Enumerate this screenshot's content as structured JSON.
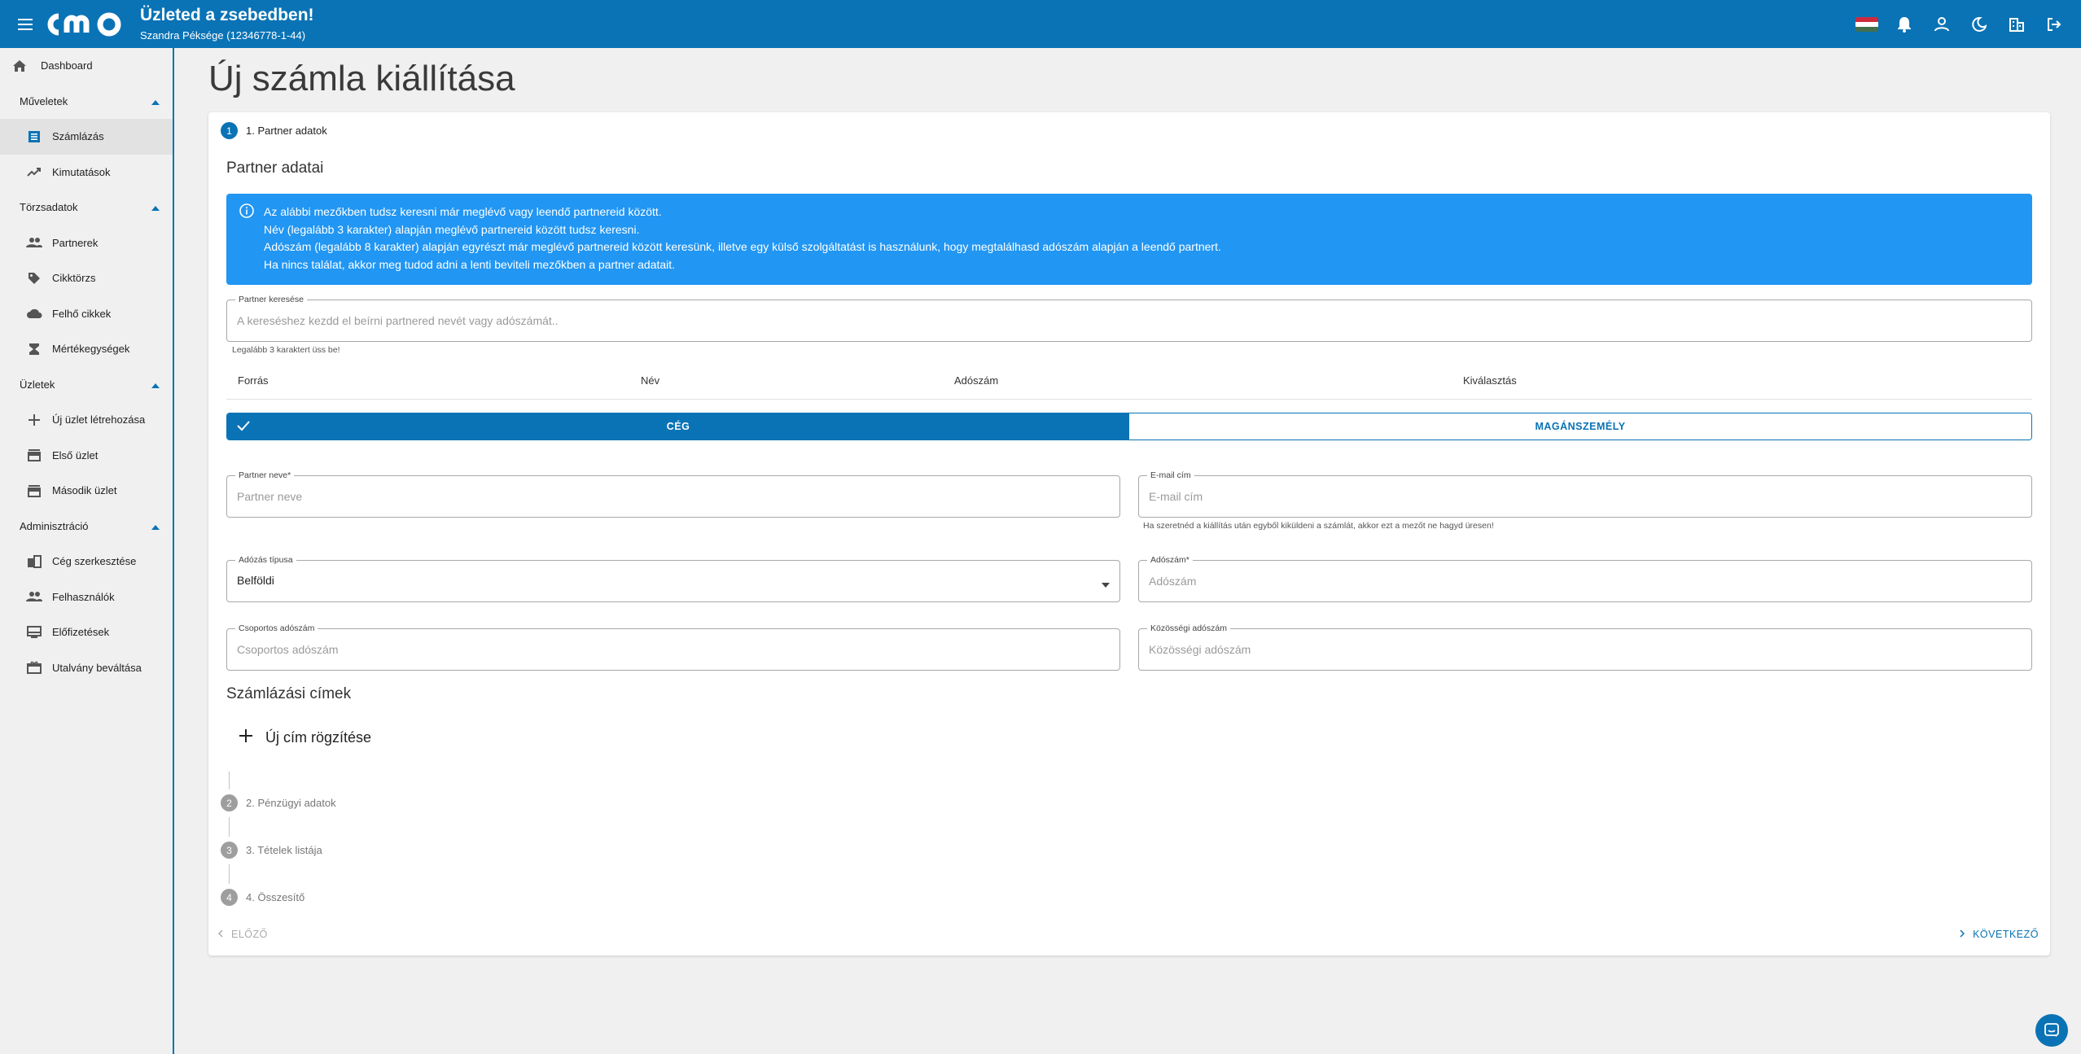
{
  "header": {
    "title": "Üzleted a zsebedben!",
    "subtitle": "Szandra Péksége (12346778-1-44)",
    "logo_text": "cmo",
    "icons": [
      "menu-icon",
      "flag-hu-icon",
      "bell-icon",
      "user-icon",
      "moon-icon",
      "building-icon",
      "logout-icon"
    ]
  },
  "sidebar": {
    "dashboard": "Dashboard",
    "sections": [
      {
        "label": "Műveletek",
        "items": [
          "Számlázás",
          "Kimutatások"
        ]
      },
      {
        "label": "Törzsadatok",
        "items": [
          "Partnerek",
          "Cikktörzs",
          "Felhő cikkek",
          "Mértékegységek"
        ]
      },
      {
        "label": "Üzletek",
        "items": [
          "Új üzlet létrehozása",
          "Első üzlet",
          "Második üzlet"
        ]
      },
      {
        "label": "Adminisztráció",
        "items": [
          "Cég szerkesztése",
          "Felhasználók",
          "Előfizetések",
          "Utalvány beváltása"
        ]
      }
    ],
    "active_item": "Számlázás"
  },
  "page": {
    "title": "Új számla kiállítása"
  },
  "steps": [
    {
      "num": "1",
      "label": "1. Partner adatok"
    },
    {
      "num": "2",
      "label": "2. Pénzügyi adatok"
    },
    {
      "num": "3",
      "label": "3. Tételek listája"
    },
    {
      "num": "4",
      "label": "4. Összesítő"
    }
  ],
  "partner": {
    "section_title": "Partner adatai",
    "alert_lines": [
      "Az alábbi mezőkben tudsz keresni már meglévő vagy leendő partnereid között.",
      "Név (legalább 3 karakter) alapján meglévő partnereid között tudsz keresni.",
      "Adószám (legalább 8 karakter) alapján egyrészt már meglévő partnereid között keresünk, illetve egy külső szolgáltatást is használunk, hogy megtalálhasd adószám alapján a leendő partnert.",
      "Ha nincs találat, akkor meg tudod adni a lenti beviteli mezőkben a partner adatait."
    ],
    "search_label": "Partner keresése",
    "search_placeholder": "A kereséshez kezdd el beírni partnered nevét vagy adószámát..",
    "search_hint": "Legalább 3 karaktert üss be!",
    "table_headers": [
      "Forrás",
      "Név",
      "Adószám",
      "Kiválasztás"
    ],
    "toggle": {
      "company": "CÉG",
      "private": "MAGÁNSZEMÉLY",
      "selected": "CÉG"
    },
    "name_label": "Partner neve*",
    "name_placeholder": "Partner neve",
    "email_label": "E-mail cím",
    "email_placeholder": "E-mail cím",
    "email_hint": "Ha szeretnéd a kiállítás után egyből kiküldeni a számlát, akkor ezt a mezőt ne hagyd üresen!",
    "tax_type_label": "Adózás típusa",
    "tax_type_value": "Belföldi",
    "tax_number_label": "Adószám*",
    "tax_number_placeholder": "Adószám",
    "group_tax_label": "Csoportos adószám",
    "group_tax_placeholder": "Csoportos adószám",
    "eu_tax_label": "Közösségi adószám",
    "eu_tax_placeholder": "Közösségi adószám"
  },
  "billing": {
    "section_title": "Számlázási címek",
    "add_address": "Új cím rögzítése"
  },
  "footer": {
    "prev": "ELŐZŐ",
    "next": "KÖVETKEZŐ"
  },
  "colors": {
    "primary": "#0a73b5",
    "alert": "#2196f3",
    "background": "#f0f0f0"
  }
}
